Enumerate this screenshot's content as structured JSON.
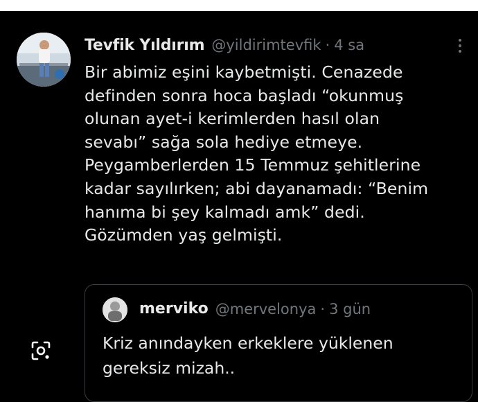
{
  "tweet": {
    "author_name": "Tevfik Yıldırım",
    "author_handle": "@yildirimtevfik",
    "separator": "·",
    "time": "4 sa",
    "text": "Bir abimiz eşini kaybetmişti. Cenazede\ndefinden sonra hoca başladı “okunmuş\nolunan ayet-i kerimlerden hasıl olan\nsevabı” sağa sola hediye etmeye.\nPeygamberlerden 15 Temmuz şehitlerine\nkadar sayılırken; abi dayanamadı: “Benim\nhanıma bi şey kalmadı amk” dedi.\nGözümden yaş gelmişti.",
    "more_icon": "more-vertical-icon"
  },
  "quoted": {
    "author_name": "merviko",
    "author_handle": "@mervelonya",
    "separator": "·",
    "time": "3 gün",
    "text": "Kriz anındayken erkeklere yüklenen\ngereksiz mizah.."
  },
  "overlay": {
    "lens_icon": "lens-search-icon"
  },
  "colors": {
    "background": "#000000",
    "text": "#e7e9ea",
    "muted": "#71767b",
    "border": "#3a3d42"
  }
}
